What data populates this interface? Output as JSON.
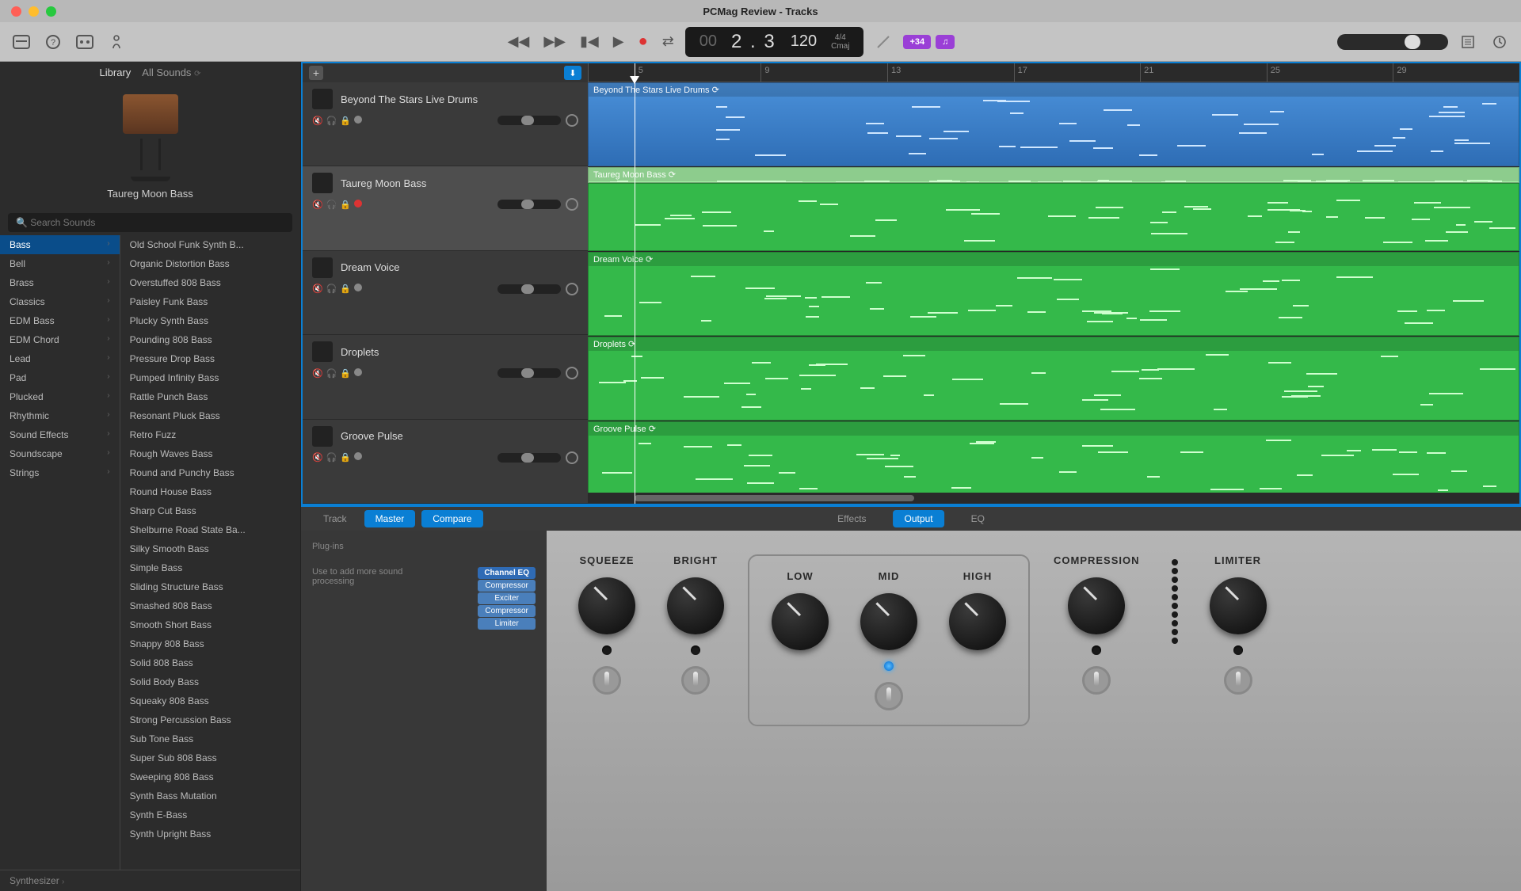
{
  "window": {
    "title": "PCMag Review - Tracks"
  },
  "transport": {
    "position": "2 . 3",
    "position_prefix": "00",
    "tempo": "120",
    "sig_top": "4/4",
    "sig_bottom": "Cmaj",
    "badge1": "+34",
    "badge2": "♫"
  },
  "library": {
    "tab1": "Library",
    "tab2": "All Sounds",
    "instrument_name": "Taureg Moon Bass",
    "search_placeholder": "Search Sounds",
    "categories": [
      "Bass",
      "Bell",
      "Brass",
      "Classics",
      "EDM Bass",
      "EDM Chord",
      "Lead",
      "Pad",
      "Plucked",
      "Rhythmic",
      "Sound Effects",
      "Soundscape",
      "Strings"
    ],
    "sounds": [
      "Old School Funk Synth B...",
      "Organic Distortion Bass",
      "Overstuffed 808 Bass",
      "Paisley Funk Bass",
      "Plucky Synth Bass",
      "Pounding 808 Bass",
      "Pressure Drop Bass",
      "Pumped Infinity Bass",
      "Rattle Punch Bass",
      "Resonant Pluck Bass",
      "Retro Fuzz",
      "Rough Waves Bass",
      "Round and Punchy Bass",
      "Round House Bass",
      "Sharp Cut Bass",
      "Shelburne Road State Ba...",
      "Silky Smooth Bass",
      "Simple Bass",
      "Sliding Structure Bass",
      "Smashed 808 Bass",
      "Smooth Short Bass",
      "Snappy 808 Bass",
      "Solid 808 Bass",
      "Solid Body Bass",
      "Squeaky 808 Bass",
      "Strong Percussion Bass",
      "Sub Tone Bass",
      "Super Sub 808 Bass",
      "Sweeping 808 Bass",
      "Synth Bass Mutation",
      "Synth E-Bass",
      "Synth Upright Bass"
    ],
    "footer": "Synthesizer"
  },
  "tracks": [
    {
      "name": "Beyond The Stars Live Drums",
      "color": "blue",
      "region_name": "Beyond The Stars Live Drums",
      "dot_color": "#888"
    },
    {
      "name": "Taureg Moon Bass",
      "color": "lightgreen",
      "region_name": "Taureg Moon Bass",
      "selected": true,
      "dot_color": "#d33"
    },
    {
      "name": "Dream Voice",
      "color": "green",
      "region_name": "Dream Voice",
      "dot_color": "#888"
    },
    {
      "name": "Droplets",
      "color": "green",
      "region_name": "Droplets",
      "dot_color": "#888"
    },
    {
      "name": "Groove Pulse",
      "color": "green",
      "region_name": "Groove Pulse",
      "dot_color": "#888"
    }
  ],
  "ruler": [
    "5",
    "9",
    "13",
    "17",
    "21",
    "25",
    "29"
  ],
  "editor": {
    "tab_track": "Track",
    "tab_master": "Master",
    "tab_compare": "Compare",
    "sub_effects": "Effects",
    "sub_output": "Output",
    "sub_eq": "EQ",
    "plugins_label": "Plug-ins",
    "help_text": "Use to add more sound processing",
    "plugins": [
      "Channel EQ",
      "Compressor",
      "Exciter",
      "Compressor",
      "Limiter"
    ],
    "knobs": {
      "squeeze": "SQUEEZE",
      "bright": "BRIGHT",
      "low": "LOW",
      "mid": "MID",
      "high": "HIGH",
      "compression": "COMPRESSION",
      "limiter": "LIMITER"
    }
  }
}
